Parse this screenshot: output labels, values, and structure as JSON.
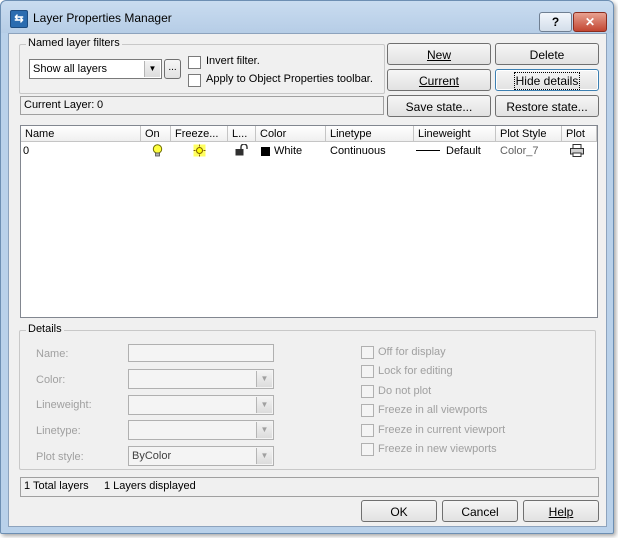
{
  "window": {
    "title": "Layer Properties Manager",
    "help_glyph": "?",
    "close_glyph": "✕"
  },
  "filters": {
    "group_label": "Named layer filters",
    "selected_filter": "Show all layers",
    "ellipsis": "...",
    "invert_filter_label": "Invert filter.",
    "apply_toolbar_label": "Apply to Object Properties toolbar."
  },
  "buttons": {
    "new": "New",
    "delete": "Delete",
    "current": "Current",
    "hide_details": "Hide details",
    "save_state": "Save state...",
    "restore_state": "Restore state...",
    "ok": "OK",
    "cancel": "Cancel",
    "help": "Help"
  },
  "current_layer": {
    "label": "Current Layer:",
    "value": "0"
  },
  "layers_table": {
    "columns": [
      "Name",
      "On",
      "Freeze...",
      "L...",
      "Color",
      "Linetype",
      "Lineweight",
      "Plot Style",
      "Plot"
    ],
    "rows": [
      {
        "name": "0",
        "on": "lightbulb-on",
        "freeze": "sun-thawed",
        "lock": "lock-open",
        "color_name": "White",
        "color_swatch": "#000000",
        "linetype": "Continuous",
        "lineweight": "Default",
        "plot_style": "Color_7",
        "plot": "printer"
      }
    ]
  },
  "details": {
    "group_label": "Details",
    "name_label": "Name:",
    "color_label": "Color:",
    "lineweight_label": "Lineweight:",
    "linetype_label": "Linetype:",
    "plot_style_label": "Plot style:",
    "plot_style_value": "ByColor",
    "checkboxes": [
      "Off for display",
      "Lock for editing",
      "Do not plot",
      "Freeze in all viewports",
      "Freeze in current viewport",
      "Freeze in new viewports"
    ]
  },
  "status": {
    "total": "1 Total layers",
    "displayed": "1 Layers displayed"
  },
  "colors": {
    "accent": "#b9d1ea",
    "dialog_bg": "#f0f0f0",
    "disabled_text": "#a0a0a0"
  }
}
